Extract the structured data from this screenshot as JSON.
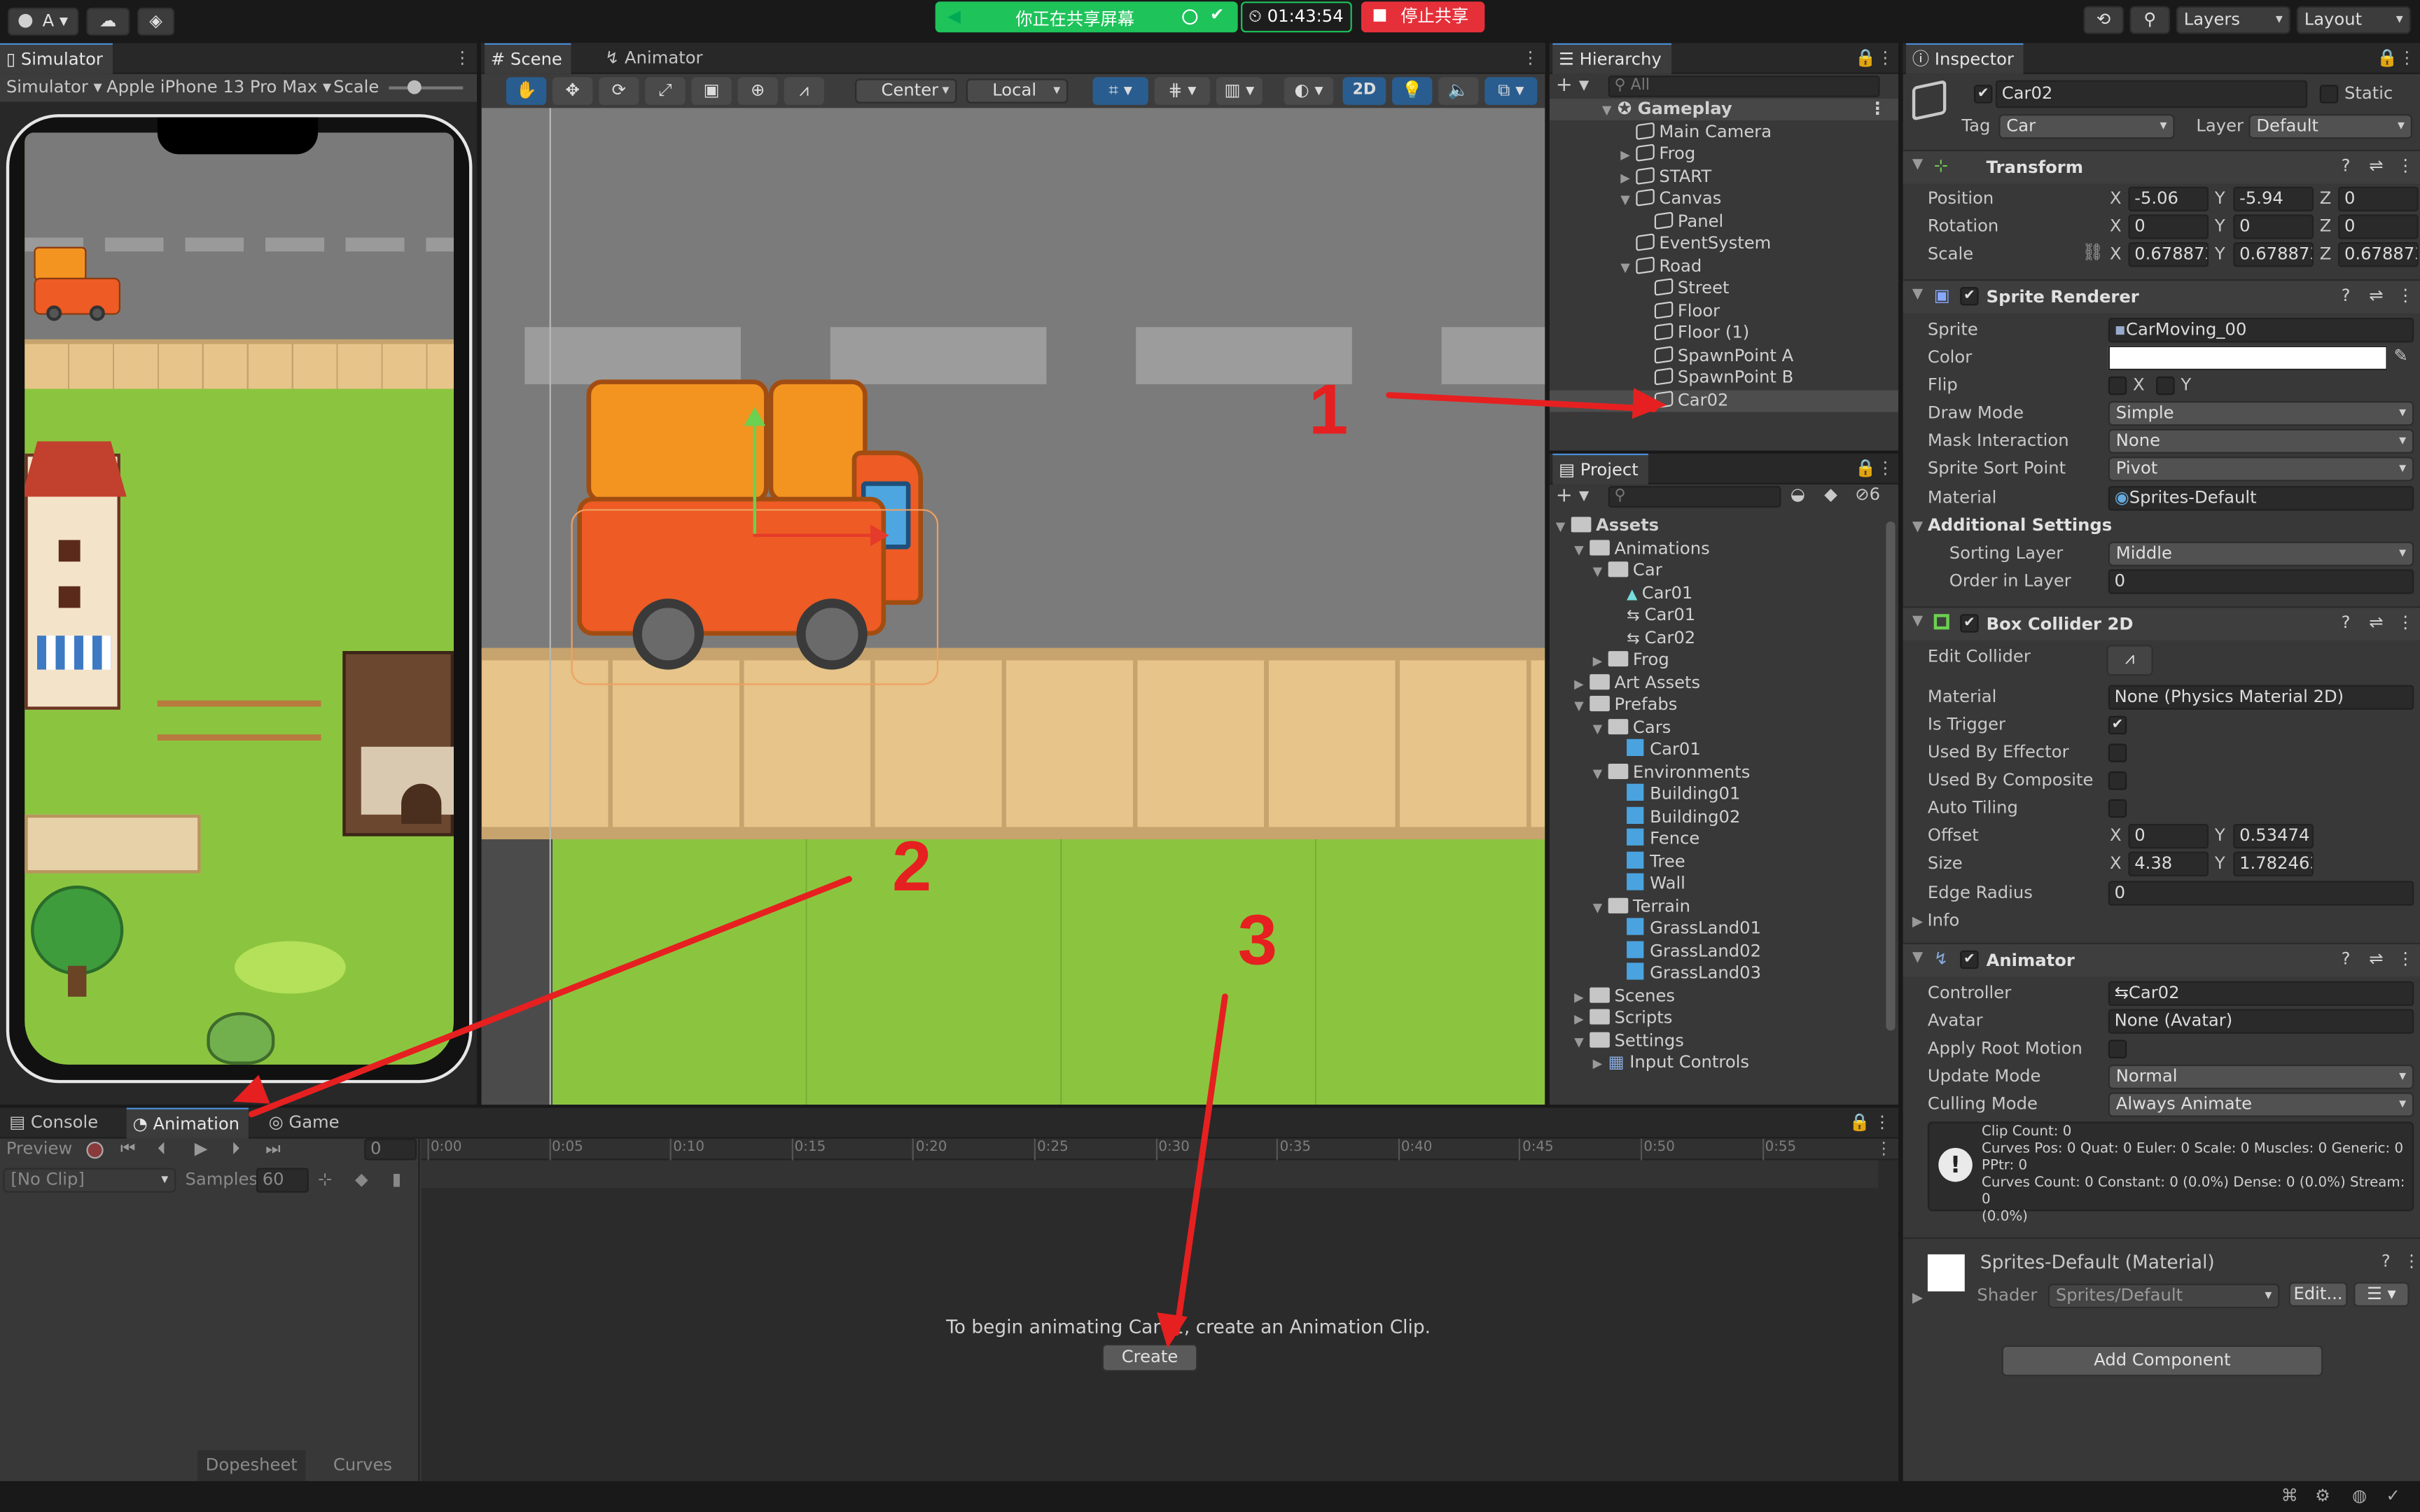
{
  "topbar": {
    "account": "A",
    "share_status": "你正在共享屏幕",
    "timer": "01:43:54",
    "stop_share": "停止共享",
    "layers": "Layers",
    "layout": "Layout"
  },
  "simulator": {
    "tab": "Simulator",
    "mode": "Simulator",
    "device": "Apple iPhone 13 Pro Max",
    "scale_label": "Scale"
  },
  "scene": {
    "tab_scene": "Scene",
    "tab_animator": "Animator",
    "pivot": "Center",
    "space": "Local",
    "mode_2d": "2D"
  },
  "hierarchy": {
    "tab": "Hierarchy",
    "search_placeholder": "All",
    "items": [
      {
        "label": "Gameplay"
      },
      {
        "label": "Main Camera"
      },
      {
        "label": "Frog"
      },
      {
        "label": "START"
      },
      {
        "label": "Canvas"
      },
      {
        "label": "Panel"
      },
      {
        "label": "EventSystem"
      },
      {
        "label": "Road"
      },
      {
        "label": "Street"
      },
      {
        "label": "Floor"
      },
      {
        "label": "Floor (1)"
      },
      {
        "label": "SpawnPoint A"
      },
      {
        "label": "SpawnPoint B"
      },
      {
        "label": "Car02"
      }
    ]
  },
  "project": {
    "tab": "Project",
    "hidden_count": "6",
    "items": [
      {
        "label": "Assets"
      },
      {
        "label": "Animations"
      },
      {
        "label": "Car"
      },
      {
        "label": "Car01"
      },
      {
        "label": "Car01"
      },
      {
        "label": "Car02"
      },
      {
        "label": "Frog"
      },
      {
        "label": "Art Assets"
      },
      {
        "label": "Prefabs"
      },
      {
        "label": "Cars"
      },
      {
        "label": "Car01"
      },
      {
        "label": "Environments"
      },
      {
        "label": "Building01"
      },
      {
        "label": "Building02"
      },
      {
        "label": "Fence"
      },
      {
        "label": "Tree"
      },
      {
        "label": "Wall"
      },
      {
        "label": "Terrain"
      },
      {
        "label": "GrassLand01"
      },
      {
        "label": "GrassLand02"
      },
      {
        "label": "GrassLand03"
      },
      {
        "label": "Scenes"
      },
      {
        "label": "Scripts"
      },
      {
        "label": "Settings"
      },
      {
        "label": "Input Controls"
      }
    ]
  },
  "inspector": {
    "tab": "Inspector",
    "name": "Car02",
    "static": "Static",
    "tag_label": "Tag",
    "tag": "Car",
    "layer_label": "Layer",
    "layer": "Default",
    "transform": {
      "title": "Transform",
      "position": "Position",
      "rotation": "Rotation",
      "scale": "Scale",
      "x": "X",
      "y": "Y",
      "z": "Z",
      "pos": [
        "-5.06",
        "-5.94",
        "0"
      ],
      "rot": [
        "0",
        "0",
        "0"
      ],
      "scl": [
        "0.678873",
        "0.678873",
        "0.678873"
      ]
    },
    "sprite_renderer": {
      "title": "Sprite Renderer",
      "sprite_label": "Sprite",
      "sprite": "CarMoving_00",
      "color_label": "Color",
      "flip_label": "Flip",
      "draw_mode_label": "Draw Mode",
      "draw_mode": "Simple",
      "mask_label": "Mask Interaction",
      "mask": "None",
      "sort_point_label": "Sprite Sort Point",
      "sort_point": "Pivot",
      "material_label": "Material",
      "material": "Sprites-Default",
      "additional": "Additional Settings",
      "sorting_layer_label": "Sorting Layer",
      "sorting_layer": "Middle",
      "order_label": "Order in Layer",
      "order": "0"
    },
    "box_collider": {
      "title": "Box Collider 2D",
      "edit_label": "Edit Collider",
      "material_label": "Material",
      "material": "None (Physics Material 2D)",
      "trigger_label": "Is Trigger",
      "effector_label": "Used By Effector",
      "composite_label": "Used By Composite",
      "tiling_label": "Auto Tiling",
      "offset_label": "Offset",
      "offset": [
        "0",
        "0.53474"
      ],
      "size_label": "Size",
      "size": [
        "4.38",
        "1.782463"
      ],
      "radius_label": "Edge Radius",
      "radius": "0",
      "info_label": "Info"
    },
    "animator": {
      "title": "Animator",
      "controller_label": "Controller",
      "controller": "Car02",
      "avatar_label": "Avatar",
      "avatar": "None (Avatar)",
      "root_motion_label": "Apply Root Motion",
      "update_label": "Update Mode",
      "update": "Normal",
      "culling_label": "Culling Mode",
      "culling": "Always Animate",
      "info_lines": [
        "Clip Count: 0",
        "Curves Pos: 0 Quat: 0 Euler: 0 Scale: 0 Muscles: 0 Generic: 0",
        "PPtr: 0",
        "Curves Count: 0 Constant: 0 (0.0%) Dense: 0 (0.0%) Stream: 0",
        "(0.0%)"
      ]
    },
    "material": {
      "title": "Sprites-Default (Material)",
      "shader_label": "Shader",
      "shader": "Sprites/Default",
      "edit": "Edit..."
    },
    "add_component": "Add Component"
  },
  "bottom": {
    "tab_console": "Console",
    "tab_animation": "Animation",
    "tab_game": "Game",
    "preview": "Preview",
    "frame": "0",
    "clip": "[No Clip]",
    "samples_label": "Samples",
    "samples": "60",
    "ticks": [
      "0:00",
      "0:05",
      "0:10",
      "0:15",
      "0:20",
      "0:25",
      "0:30",
      "0:35",
      "0:40",
      "0:45",
      "0:50",
      "0:55"
    ],
    "message": "To begin animating Car02, create an Animation Clip.",
    "create": "Create",
    "dopesheet": "Dopesheet",
    "curves": "Curves"
  },
  "annotations": [
    "1",
    "2",
    "3"
  ]
}
